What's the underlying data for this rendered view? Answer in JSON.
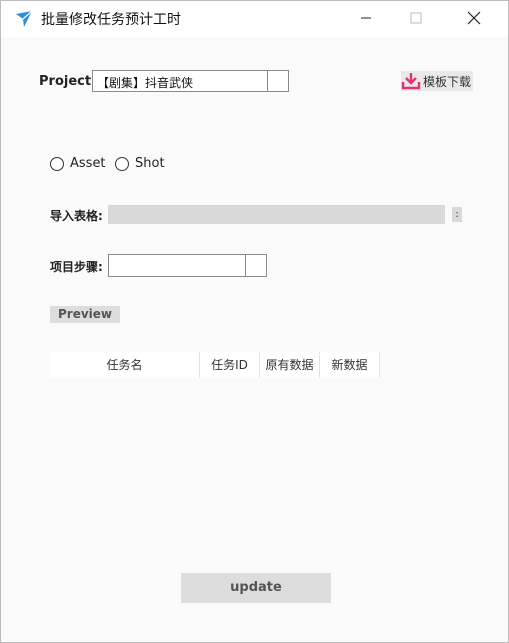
{
  "window": {
    "title": "批量修改任务预计工时"
  },
  "form": {
    "project_label": "Project:",
    "project_value": "【剧集】抖音武侠",
    "template_button": "模板下载",
    "type_options": [
      "Asset",
      "Shot"
    ],
    "import_label": "导入表格:",
    "file_button": ":",
    "step_label": "项目步骤:",
    "step_value": "",
    "preview_button": "Preview"
  },
  "table": {
    "columns": [
      "任务名",
      "任务ID",
      "原有数据",
      "新数据"
    ]
  },
  "footer": {
    "update_button": "update"
  },
  "colors": {
    "accent_icon": "#e0327a",
    "app_icon": "#2a8fd8"
  }
}
